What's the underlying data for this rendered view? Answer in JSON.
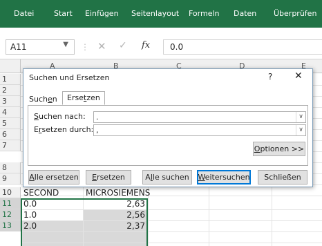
{
  "ribbon": {
    "tabs": [
      "Datei",
      "Start",
      "Einfügen",
      "Seitenlayout",
      "Formeln",
      "Daten",
      "Überprüfen"
    ]
  },
  "formula_bar": {
    "name_box": "A11",
    "cancel_symbol": "✕",
    "confirm_symbol": "✓",
    "fx_symbol": "fx",
    "value": "0.0"
  },
  "grid": {
    "columns": [
      "A",
      "B",
      "C",
      "D",
      "E"
    ],
    "rows": [
      {
        "num": "1",
        "a": "",
        "b": ""
      },
      {
        "num": "2",
        "a": "",
        "b": ""
      },
      {
        "num": "3",
        "a": "",
        "b": ""
      },
      {
        "num": "4",
        "a": "",
        "b": ""
      },
      {
        "num": "5",
        "a": "",
        "b": ""
      },
      {
        "num": "6",
        "a": "",
        "b": ""
      },
      {
        "num": "7",
        "a": "",
        "b": ""
      },
      {
        "num": "8",
        "a": "",
        "b": ""
      },
      {
        "num": "9",
        "a": "",
        "b": ""
      },
      {
        "num": "10",
        "a": "SECOND",
        "b": "MICROSIEMENS"
      },
      {
        "num": "11",
        "a": "0.0",
        "b": "2,63"
      },
      {
        "num": "12",
        "a": "1.0",
        "b": "2,56"
      },
      {
        "num": "13",
        "a": "2.0",
        "b": "2,37"
      }
    ]
  },
  "dialog": {
    "title": "Suchen und Ersetzen",
    "help": "?",
    "close": "✕",
    "tab_suchen_pre": "Such",
    "tab_suchen_u": "e",
    "tab_suchen_post": "n",
    "tab_ersetzen_pre": "Erse",
    "tab_ersetzen_u": "t",
    "tab_ersetzen_post": "zen",
    "find_label_u": "S",
    "find_label_post": "uchen nach:",
    "find_value": ".",
    "replace_label_pre": "E",
    "replace_label_u": "r",
    "replace_label_post": "setzen durch:",
    "replace_value": ",",
    "dropdown_symbol": "∨",
    "options_u": "O",
    "options_post": "ptionen >>",
    "buttons": {
      "replace_all_u": "A",
      "replace_all_post": "lle ersetzen",
      "replace_u": "E",
      "replace_post": "rsetzen",
      "find_all_pre": "A",
      "find_all_u": "l",
      "find_all_post": "le suchen",
      "find_next_u": "W",
      "find_next_post": "eitersuchen",
      "close": "Schließen"
    }
  },
  "colors": {
    "ribbon": "#217346",
    "selection_border": "#217346",
    "dialog_default_button": "#0078d7"
  }
}
